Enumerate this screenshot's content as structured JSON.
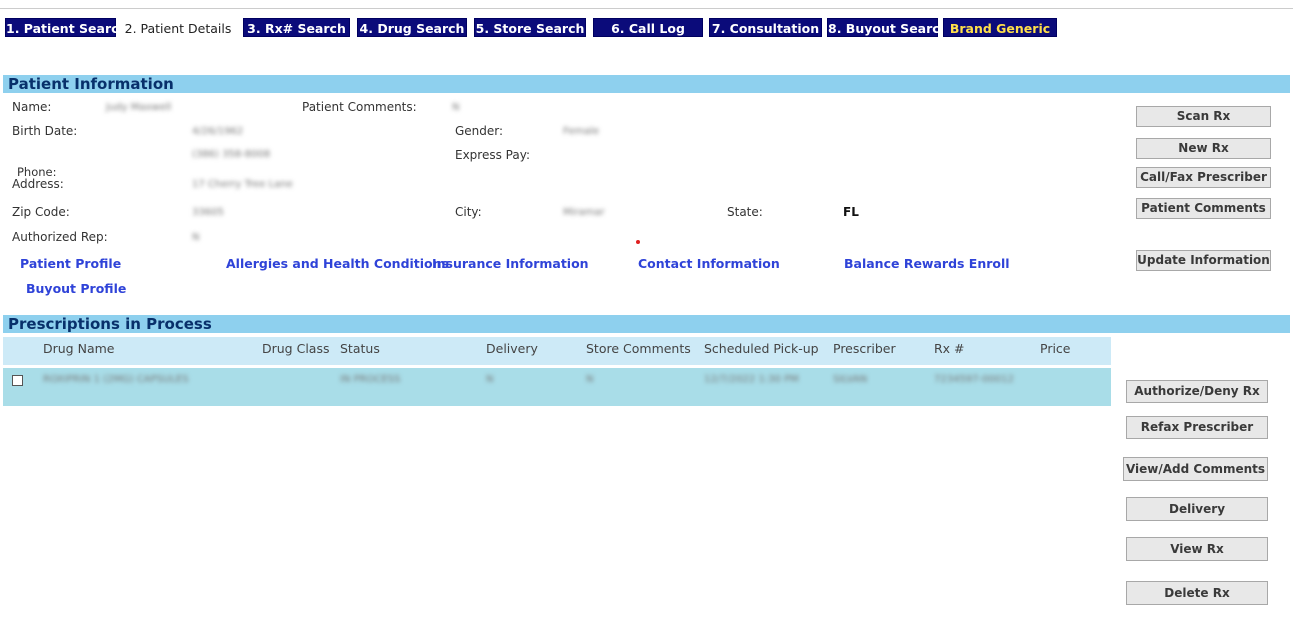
{
  "tabs": [
    {
      "label": "1. Patient Search"
    },
    {
      "label": "2. Patient Details"
    },
    {
      "label": "3. Rx# Search"
    },
    {
      "label": "4. Drug Search"
    },
    {
      "label": "5. Store Search"
    },
    {
      "label": "6. Call Log"
    },
    {
      "label": "7. Consultation"
    },
    {
      "label": "8. Buyout Search"
    },
    {
      "label": "Brand Generic"
    }
  ],
  "patient_info": {
    "header": "Patient Information",
    "name_label": "Name:",
    "name_value": "Judy Maxwell",
    "comments_label": "Patient Comments:",
    "comments_value": "N",
    "birth_label": "Birth Date:",
    "birth_value": "4/26/1962",
    "gender_label": "Gender:",
    "gender_value": "Female",
    "phone_value": "(386) 358-8008",
    "express_label": "Express Pay:",
    "phone_label": "Phone:",
    "address_label": "Address:",
    "address_value": "17 Cherry Tree Lane",
    "zip_label": "Zip Code:",
    "zip_value": "33605",
    "city_label": "City:",
    "city_value": "Miramar",
    "state_label": "State:",
    "state_value": "FL",
    "auth_label": "Authorized Rep:",
    "auth_value": "N"
  },
  "links": {
    "patient_profile": "Patient Profile",
    "allergies": "Allergies and Health Conditions",
    "insurance": "Insurance Information",
    "contact": "Contact Information",
    "balance": "Balance Rewards Enroll",
    "buyout": "Buyout Profile"
  },
  "side_buttons": {
    "scan_rx": "Scan Rx",
    "new_rx": "New Rx",
    "call_fax": "Call/Fax Prescriber",
    "patient_comments": "Patient Comments",
    "update_info": "Update Information"
  },
  "prescriptions": {
    "header": "Prescriptions in Process",
    "columns": [
      "Drug Name",
      "Drug Class",
      "Status",
      "Delivery",
      "Store Comments",
      "Scheduled Pick-up",
      "Prescriber",
      "Rx #",
      "Price"
    ],
    "rows": [
      {
        "drug": "ROXIPRIN 1 (2MG) CAPSULES",
        "class": "",
        "status": "IN PROCESS",
        "delivery": "N",
        "store_comments": "N",
        "pickup": "12/7/2022 1:30 PM",
        "prescriber": "SILVAN",
        "rx": "7234597-00012",
        "price": ""
      }
    ]
  },
  "rx_buttons": {
    "authorize": "Authorize/Deny Rx",
    "refax": "Refax Prescriber",
    "comments": "View/Add Comments",
    "delivery": "Delivery",
    "view": "View Rx",
    "delete": "Delete Rx"
  }
}
